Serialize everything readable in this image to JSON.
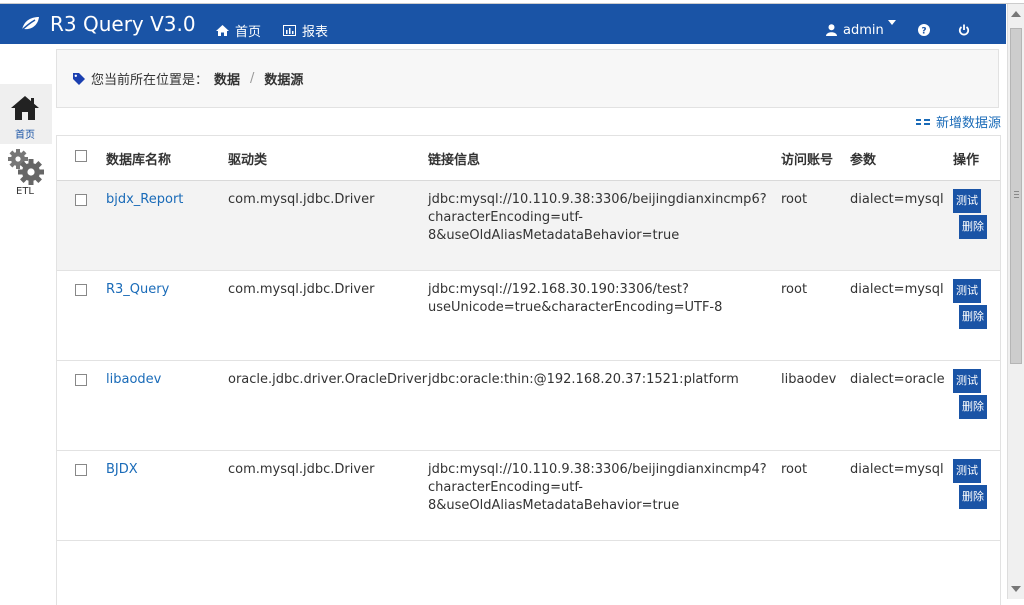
{
  "app": {
    "title": "R3 Query V3.0"
  },
  "nav": {
    "home": "首页",
    "report": "报表",
    "user": "admin"
  },
  "sidebar": {
    "items": [
      {
        "label": "首页",
        "icon": "home-icon"
      },
      {
        "label": "ETL",
        "icon": "gears-icon"
      }
    ]
  },
  "breadcrumb": {
    "prefix": "您当前所在位置是：",
    "levels": [
      "数据",
      "数据源"
    ],
    "separator": "/"
  },
  "actions": {
    "add_datasource": "新增数据源"
  },
  "table": {
    "columns": [
      "数据库名称",
      "驱动类",
      "链接信息",
      "访问账号",
      "参数",
      "操作"
    ],
    "rows": [
      {
        "name": "bjdx_Report",
        "driver": "com.mysql.jdbc.Driver",
        "url_lines": [
          "jdbc:mysql://10.110.9.38:3306/beijingdianxincmp6?",
          "characterEncoding=utf-",
          "8&useOldAliasMetadataBehavior=true"
        ],
        "account": "root",
        "params": "dialect=mysql"
      },
      {
        "name": "R3_Query",
        "driver": "com.mysql.jdbc.Driver",
        "url_lines": [
          "jdbc:mysql://192.168.30.190:3306/test?",
          "useUnicode=true&characterEncoding=UTF-8"
        ],
        "account": "root",
        "params": "dialect=mysql"
      },
      {
        "name": "libaodev",
        "driver": "oracle.jdbc.driver.OracleDriver",
        "url_lines": [
          "jdbc:oracle:thin:@192.168.20.37:1521:platform"
        ],
        "account": "libaodev",
        "params": "dialect=oracle"
      },
      {
        "name": "BJDX",
        "driver": "com.mysql.jdbc.Driver",
        "url_lines": [
          "jdbc:mysql://10.110.9.38:3306/beijingdianxincmp4?",
          "characterEncoding=utf-",
          "8&useOldAliasMetadataBehavior=true"
        ],
        "account": "root",
        "params": "dialect=mysql"
      }
    ],
    "btn_test": "测试",
    "btn_delete": "删除"
  },
  "colors": {
    "navbar": "#1a54a6",
    "link": "#1a6bb8"
  }
}
